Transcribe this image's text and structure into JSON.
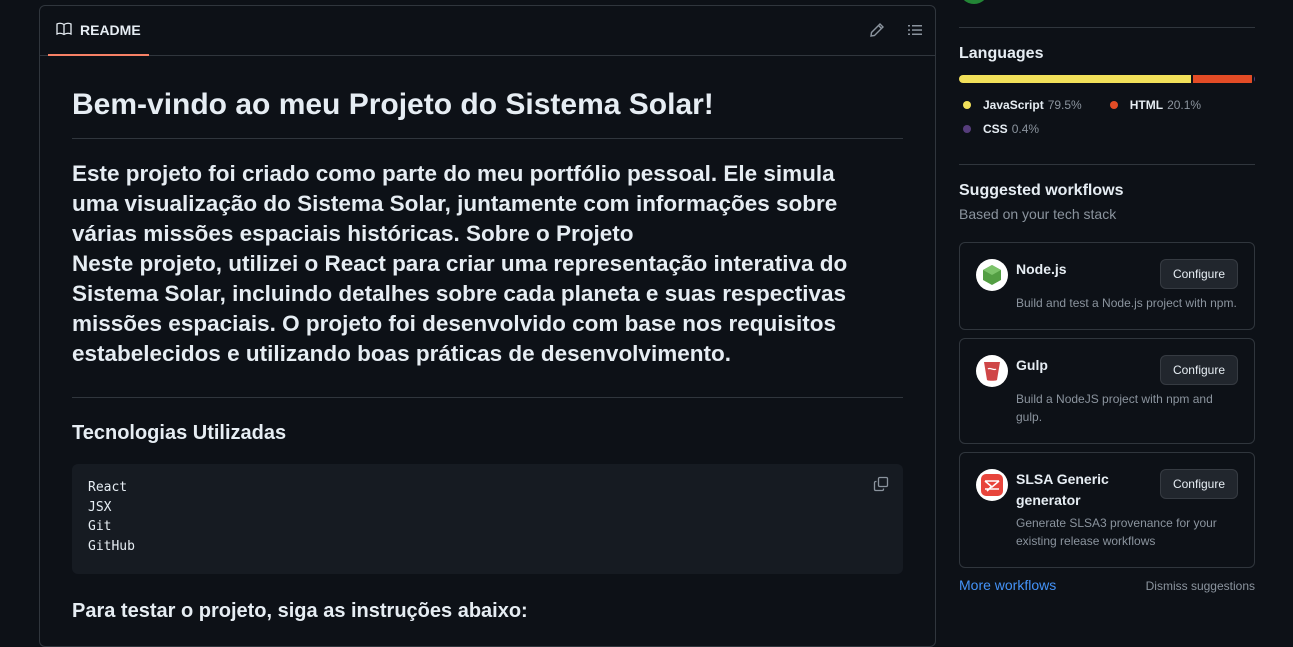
{
  "readme": {
    "tab_label": "README",
    "title": "Bem-vindo ao meu Projeto do Sistema Solar!",
    "lead_lines": [
      "Este projeto foi criado como parte do meu portfólio pessoal. Ele simula",
      "uma visualização do Sistema Solar, juntamente com informações sobre",
      "várias missões espaciais históricas. Sobre o Projeto",
      "Neste projeto, utilizei o React para criar uma representação interativa do",
      "Sistema Solar, incluindo detalhes sobre cada planeta e suas respectivas",
      "missões espaciais. O projeto foi desenvolvido com base nos requisitos",
      "estabelecidos e utilizando boas práticas de desenvolvimento."
    ],
    "tech_heading": "Tecnologias Utilizadas",
    "code_lines": [
      "React",
      "JSX",
      "Git",
      "GitHub"
    ],
    "test_heading": "Para testar o projeto, siga as instruções abaixo:"
  },
  "languages": {
    "title": "Languages",
    "items": [
      {
        "name": "JavaScript",
        "percent": "79.5%",
        "value": 79.5,
        "color": "#f1e05a"
      },
      {
        "name": "HTML",
        "percent": "20.1%",
        "value": 20.1,
        "color": "#e34c26"
      },
      {
        "name": "CSS",
        "percent": "0.4%",
        "value": 0.4,
        "color": "#563d7c"
      }
    ]
  },
  "workflows": {
    "title": "Suggested workflows",
    "subtitle": "Based on your tech stack",
    "cards": [
      {
        "name": "Node.js",
        "button": "Configure",
        "description": "Build and test a Node.js project with npm.",
        "icon": "nodejs-icon"
      },
      {
        "name": "Gulp",
        "button": "Configure",
        "description": "Build a NodeJS project with npm and gulp.",
        "icon": "gulp-icon"
      },
      {
        "name": "SLSA Generic generator",
        "button": "Configure",
        "description": "Generate SLSA3 provenance for your existing release workflows",
        "icon": "slsa-icon"
      }
    ],
    "more_link": "More workflows",
    "dismiss": "Dismiss suggestions"
  }
}
